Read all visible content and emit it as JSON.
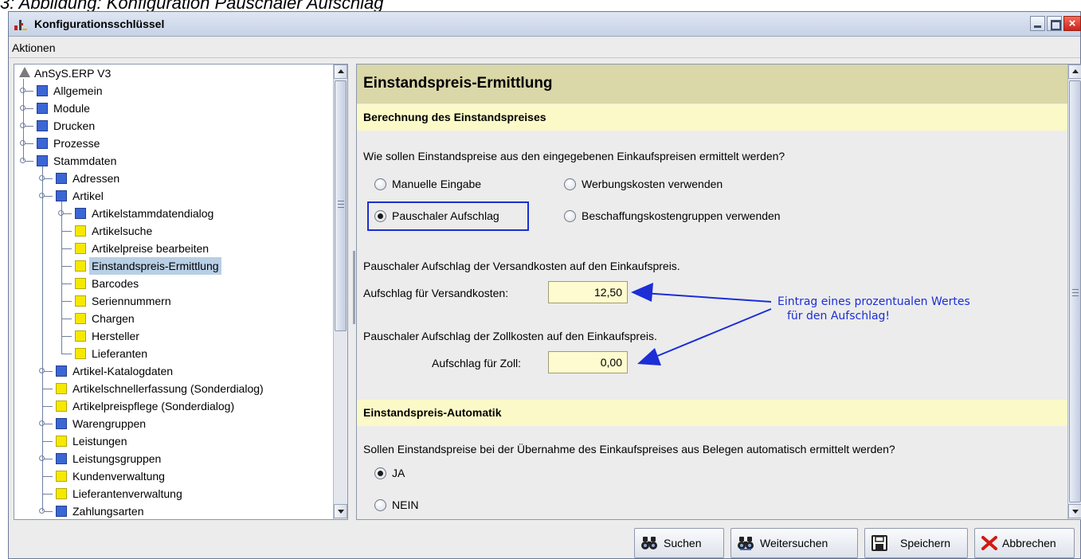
{
  "caption": "3: Abbildung: Konfiguration Pauschaler Aufschlag",
  "window": {
    "title": "Konfigurationsschlüssel",
    "close_glyph": "×",
    "menu": [
      "Aktionen"
    ]
  },
  "tree": {
    "root": "AnSyS.ERP V3",
    "items": [
      {
        "label": "Allgemein",
        "level": 1,
        "icon": "blue",
        "expandable": true,
        "selected": false
      },
      {
        "label": "Module",
        "level": 1,
        "icon": "blue",
        "expandable": true,
        "selected": false
      },
      {
        "label": "Drucken",
        "level": 1,
        "icon": "blue",
        "expandable": true,
        "selected": false
      },
      {
        "label": "Prozesse",
        "level": 1,
        "icon": "blue",
        "expandable": true,
        "selected": false
      },
      {
        "label": "Stammdaten",
        "level": 1,
        "icon": "blue",
        "expandable": true,
        "selected": false
      },
      {
        "label": "Adressen",
        "level": 2,
        "icon": "blue",
        "expandable": true,
        "selected": false
      },
      {
        "label": "Artikel",
        "level": 2,
        "icon": "blue",
        "expandable": true,
        "selected": false
      },
      {
        "label": "Artikelstammdatendialog",
        "level": 3,
        "icon": "blue",
        "expandable": true,
        "selected": false
      },
      {
        "label": "Artikelsuche",
        "level": 3,
        "icon": "yellow",
        "expandable": false,
        "selected": false
      },
      {
        "label": "Artikelpreise bearbeiten",
        "level": 3,
        "icon": "yellow",
        "expandable": false,
        "selected": false
      },
      {
        "label": "Einstandspreis-Ermittlung",
        "level": 3,
        "icon": "yellow",
        "expandable": false,
        "selected": true
      },
      {
        "label": "Barcodes",
        "level": 3,
        "icon": "yellow",
        "expandable": false,
        "selected": false
      },
      {
        "label": "Seriennummern",
        "level": 3,
        "icon": "yellow",
        "expandable": false,
        "selected": false
      },
      {
        "label": "Chargen",
        "level": 3,
        "icon": "yellow",
        "expandable": false,
        "selected": false
      },
      {
        "label": "Hersteller",
        "level": 3,
        "icon": "yellow",
        "expandable": false,
        "selected": false
      },
      {
        "label": "Lieferanten",
        "level": 3,
        "icon": "yellow",
        "expandable": false,
        "selected": false
      },
      {
        "label": "Artikel-Katalogdaten",
        "level": 2,
        "icon": "blue",
        "expandable": true,
        "selected": false
      },
      {
        "label": "Artikelschnellerfassung (Sonderdialog)",
        "level": 2,
        "icon": "yellow",
        "expandable": false,
        "selected": false
      },
      {
        "label": "Artikelpreispflege (Sonderdialog)",
        "level": 2,
        "icon": "yellow",
        "expandable": false,
        "selected": false
      },
      {
        "label": "Warengruppen",
        "level": 2,
        "icon": "blue",
        "expandable": true,
        "selected": false
      },
      {
        "label": "Leistungen",
        "level": 2,
        "icon": "yellow",
        "expandable": false,
        "selected": false
      },
      {
        "label": "Leistungsgruppen",
        "level": 2,
        "icon": "blue",
        "expandable": true,
        "selected": false
      },
      {
        "label": "Kundenverwaltung",
        "level": 2,
        "icon": "yellow",
        "expandable": false,
        "selected": false
      },
      {
        "label": "Lieferantenverwaltung",
        "level": 2,
        "icon": "yellow",
        "expandable": false,
        "selected": false
      },
      {
        "label": "Zahlungsarten",
        "level": 2,
        "icon": "blue",
        "expandable": true,
        "selected": false
      }
    ]
  },
  "panel": {
    "title": "Einstandspreis-Ermittlung",
    "section1": {
      "header": "Berechnung des Einstandspreises",
      "question": "Wie sollen Einstandspreise aus den eingegebenen Einkaufspreisen ermittelt werden?",
      "options": {
        "manual": "Manuelle Eingabe",
        "werbung": "Werbungskosten verwenden",
        "pauschal": "Pauschaler Aufschlag",
        "beschaffung": "Beschaffungskostengruppen verwenden"
      },
      "selected": "pauschal",
      "versand_desc": "Pauschaler Aufschlag der Versandkosten auf den Einkaufspreis.",
      "versand_label": "Aufschlag für Versandkosten:",
      "versand_value": "12,50",
      "zoll_desc": "Pauschaler Aufschlag der Zollkosten auf den Einkaufspreis.",
      "zoll_label": "Aufschlag für Zoll:",
      "zoll_value": "0,00"
    },
    "annotation": {
      "line1": "Eintrag eines prozentualen Wertes",
      "line2": "für den Aufschlag!",
      "color": "#1c2ed6"
    },
    "section2": {
      "header": "Einstandspreis-Automatik",
      "question": "Sollen Einstandspreise bei der Übernahme des Einkaufspreises aus Belegen automatisch ermittelt werden?",
      "options": {
        "yes": "JA",
        "no": "NEIN"
      },
      "selected": "yes"
    }
  },
  "toolbar": {
    "search": "Suchen",
    "search_next": "Weitersuchen",
    "save": "Speichern",
    "cancel": "Abbrechen"
  }
}
